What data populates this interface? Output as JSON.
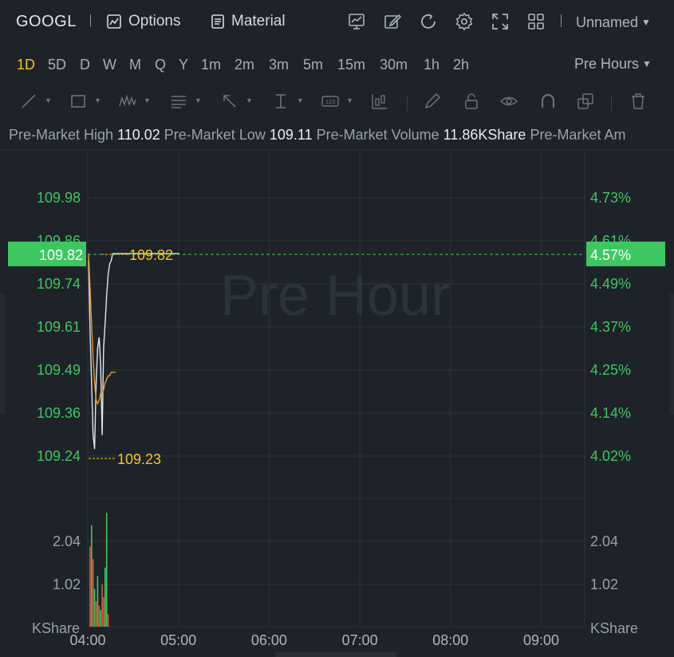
{
  "topbar": {
    "ticker": "GOOGL",
    "options_label": "Options",
    "material_label": "Material",
    "layout_name": "Unnamed"
  },
  "timeframes": {
    "items": [
      "1D",
      "5D",
      "D",
      "W",
      "M",
      "Q",
      "Y",
      "1m",
      "2m",
      "3m",
      "5m",
      "15m",
      "30m",
      "1h",
      "2h"
    ],
    "active": "1D",
    "session_label": "Pre Hours"
  },
  "info": {
    "high_label": "Pre-Market High",
    "high_value": "110.02",
    "low_label": "Pre-Market Low",
    "low_value": "109.11",
    "volume_label": "Pre-Market Volume",
    "volume_value": "11.86KShare",
    "amount_label": "Pre-Market Am"
  },
  "chart": {
    "watermark": "Pre Hour",
    "colors": {
      "up": "#3ec761",
      "down": "#e2533c",
      "price_line": "#e3e6ea",
      "avg_line": "#e59a2d",
      "highlight": "#f5c518",
      "grid": "#2e343c"
    },
    "last_price_left": "109.82",
    "last_price_right": "4.57%",
    "max_marker": "109.82",
    "min_marker": "109.23",
    "volume_unit": "KShare"
  },
  "chart_data": {
    "type": "line",
    "price_ticks": [
      "109.98",
      "109.86",
      "109.74",
      "109.61",
      "109.49",
      "109.36",
      "109.24"
    ],
    "percent_ticks": [
      "4.73%",
      "4.61%",
      "4.49%",
      "4.37%",
      "4.25%",
      "4.14%",
      "4.02%"
    ],
    "volume_ticks": [
      "2.04",
      "1.02"
    ],
    "x_ticks": [
      "04:00",
      "05:00",
      "06:00",
      "07:00",
      "08:00",
      "09:00"
    ],
    "ylim": [
      109.16,
      110.06
    ],
    "price_series": {
      "minutes": [
        0,
        1,
        2,
        3,
        4,
        5,
        6,
        7,
        8,
        9,
        10,
        11,
        12,
        13,
        14,
        15,
        16,
        18,
        20,
        25,
        30,
        35,
        40,
        50,
        60
      ],
      "values": [
        109.8,
        109.6,
        109.45,
        109.3,
        109.26,
        109.45,
        109.55,
        109.58,
        109.5,
        109.3,
        109.55,
        109.62,
        109.7,
        109.76,
        109.79,
        109.8,
        109.82,
        109.82,
        109.82,
        109.82,
        109.82,
        109.82,
        109.82,
        109.82,
        109.82
      ]
    },
    "avg_series": {
      "minutes": [
        0,
        1,
        2,
        3,
        4,
        5,
        6,
        7,
        8,
        9,
        10,
        11,
        12,
        13,
        14,
        15,
        16,
        18
      ],
      "values": [
        109.82,
        109.72,
        109.62,
        109.52,
        109.45,
        109.4,
        109.39,
        109.4,
        109.42,
        109.42,
        109.43,
        109.45,
        109.46,
        109.47,
        109.47,
        109.48,
        109.48,
        109.48
      ]
    },
    "volume_bars": {
      "minutes": [
        1,
        2,
        3,
        4,
        5,
        6,
        7,
        8,
        9,
        10,
        11,
        12,
        13
      ],
      "values": [
        1.9,
        2.4,
        1.6,
        0.9,
        0.6,
        1.2,
        0.5,
        0.4,
        1.0,
        0.7,
        1.4,
        2.7,
        0.3
      ],
      "direction": [
        "down",
        "up",
        "down",
        "up",
        "down",
        "up",
        "down",
        "up",
        "down",
        "down",
        "up",
        "up",
        "down"
      ]
    }
  }
}
